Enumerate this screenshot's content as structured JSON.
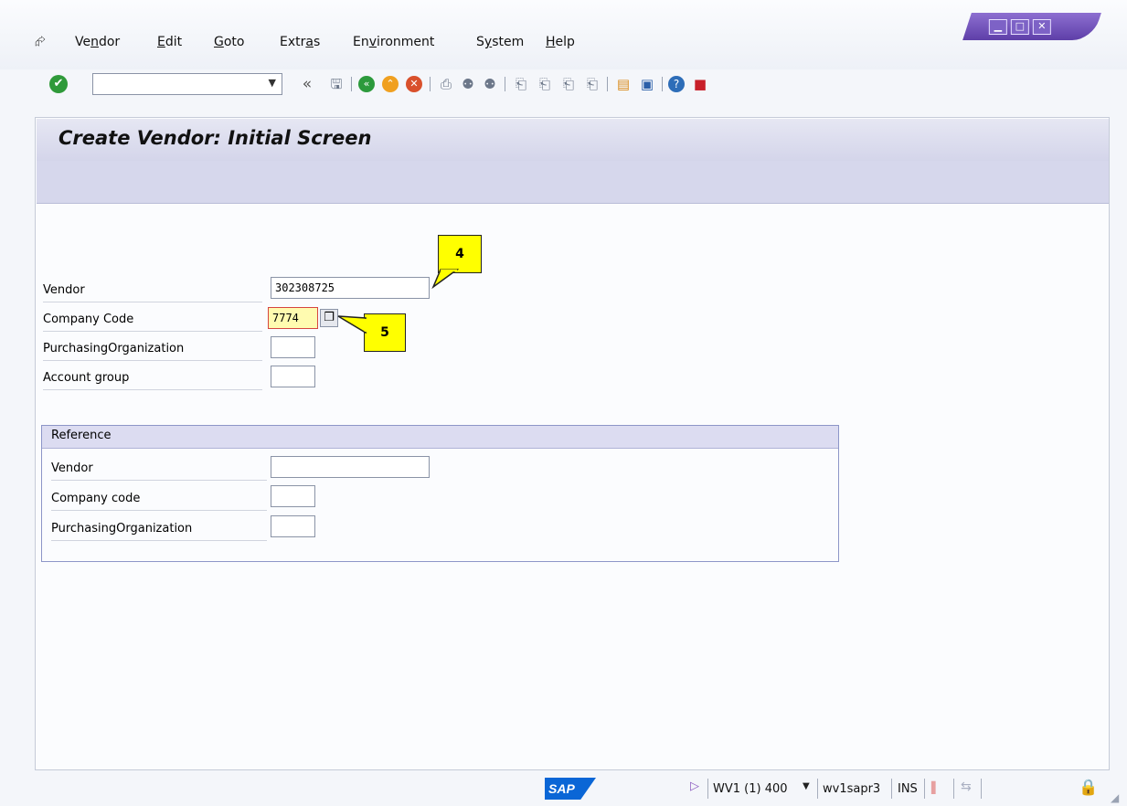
{
  "menubar": {
    "items": [
      {
        "label": "Vendor",
        "underline": "n"
      },
      {
        "label": "Edit",
        "underline": "E"
      },
      {
        "label": "Goto",
        "underline": "G"
      },
      {
        "label": "Extras",
        "underline": "a"
      },
      {
        "label": "Environment",
        "underline": "v"
      },
      {
        "label": "System",
        "underline": "y"
      },
      {
        "label": "Help",
        "underline": "H"
      }
    ]
  },
  "toolbar": {
    "command_field_value": "",
    "back_symbol": "«"
  },
  "screen": {
    "title": "Create Vendor: Initial Screen"
  },
  "form": {
    "vendor_label": "Vendor",
    "vendor_value": "302308725",
    "company_code_label": "Company Code",
    "company_code_value": "7774",
    "purch_org_label": "PurchasingOrganization",
    "purch_org_value": "",
    "account_group_label": "Account group",
    "account_group_value": ""
  },
  "reference": {
    "heading": "Reference",
    "vendor_label": "Vendor",
    "vendor_value": "",
    "company_code_label": "Company code",
    "company_code_value": "",
    "purch_org_label": "PurchasingOrganization",
    "purch_org_value": ""
  },
  "callouts": {
    "first": "4",
    "second": "5"
  },
  "statusbar": {
    "logo": "SAP",
    "system": "WV1 (1) 400",
    "server": "wv1sapr3",
    "mode": "INS"
  },
  "colors": {
    "callout_yellow": "#ffff00",
    "title_bg": "#d4d5ea",
    "window_controls": "#6a4bb5",
    "sap_blue": "#0a66d6"
  }
}
